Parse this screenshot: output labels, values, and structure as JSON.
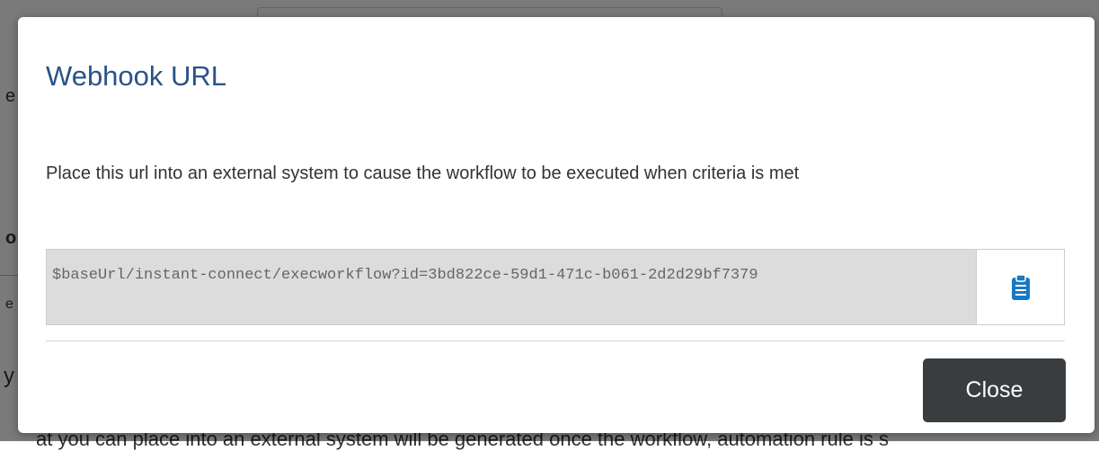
{
  "background": {
    "partial_texts": [
      "o",
      "y",
      "e",
      "e"
    ],
    "bottom_text": "at you can place into an external system will be generated once the workflow, automation rule is s"
  },
  "modal": {
    "title": "Webhook URL",
    "description": "Place this url into an external system to cause the workflow to be executed when criteria is met",
    "url_value": "$baseUrl/instant-connect/execworkflow?id=3bd822ce-59d1-471c-b061-2d2d29bf7379",
    "copy_icon": "clipboard-icon",
    "close_label": "Close"
  },
  "colors": {
    "title": "#2a5287",
    "copy_icon": "#1a78c2",
    "close_button_bg": "#3a3d40",
    "url_field_bg": "#dcdcdc"
  }
}
